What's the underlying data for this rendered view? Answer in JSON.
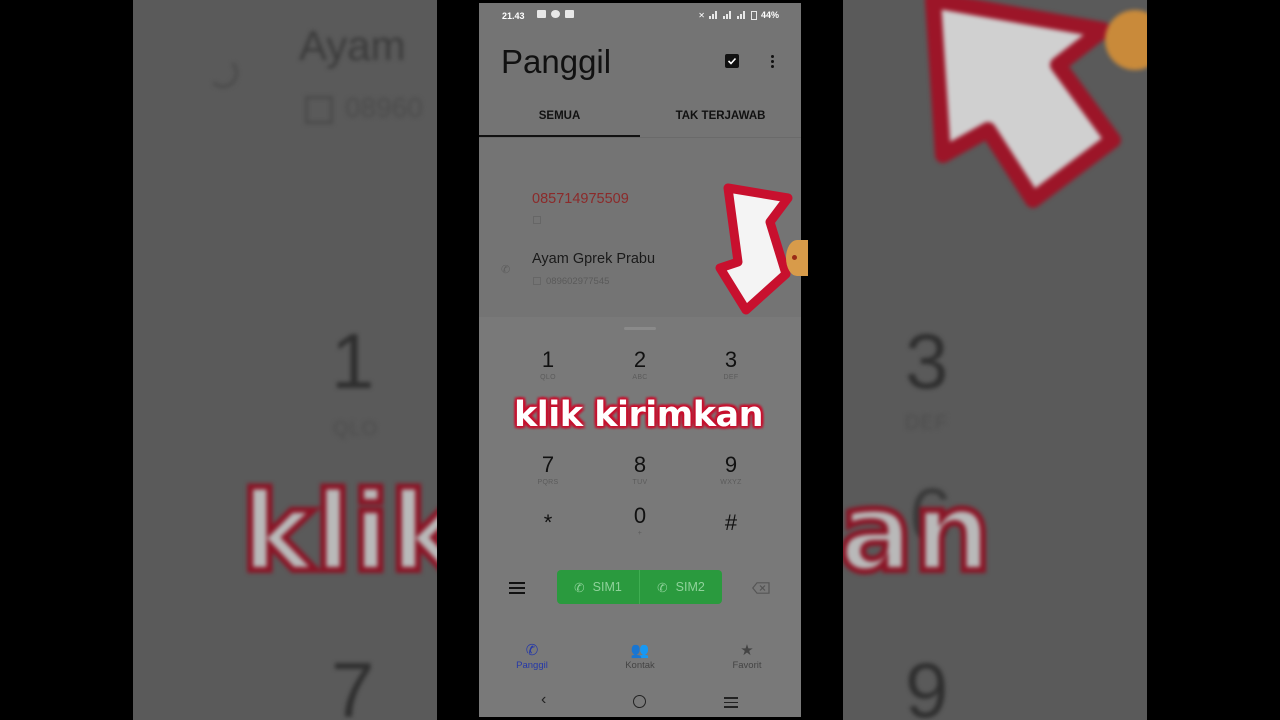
{
  "status_bar": {
    "time": "21.43",
    "battery": "44%"
  },
  "header": {
    "title": "Panggil"
  },
  "tabs": [
    {
      "label": "SEMUA",
      "active": true
    },
    {
      "label": "TAK TERJAWAB",
      "active": false
    }
  ],
  "call_log": [
    {
      "number": "085714975509",
      "missed": true
    },
    {
      "name": "Ayam Gprek Prabu",
      "number": "089602977545"
    }
  ],
  "dialpad": {
    "keys": [
      {
        "digit": "1",
        "letters": "QLO"
      },
      {
        "digit": "2",
        "letters": "ABC"
      },
      {
        "digit": "3",
        "letters": "DEF"
      },
      {
        "digit": "6",
        "letters": ""
      },
      {
        "digit": "7",
        "letters": "PQRS"
      },
      {
        "digit": "8",
        "letters": "TUV"
      },
      {
        "digit": "9",
        "letters": "WXYZ"
      },
      {
        "digit": "*",
        "letters": ""
      },
      {
        "digit": "0",
        "letters": "+"
      },
      {
        "digit": "#",
        "letters": ""
      }
    ],
    "sim1_label": "SIM1",
    "sim2_label": "SIM2"
  },
  "bottom_nav": [
    {
      "label": "Panggil",
      "icon": "phone-icon",
      "active": true
    },
    {
      "label": "Kontak",
      "icon": "contacts-icon",
      "active": false
    },
    {
      "label": "Favorit",
      "icon": "star-icon",
      "active": false
    }
  ],
  "overlay": {
    "caption": "klik kirimkan"
  },
  "background": {
    "left_name": "Ayam",
    "left_number": "08960",
    "left_digit": "1",
    "left_letters": "QLO",
    "left_big_text": "klik",
    "left_bottom_digit": "7",
    "right_digit": "3",
    "right_letters": "DEF",
    "right_mid_digit": "6",
    "right_big_text": "an",
    "right_bottom_digit": "9"
  },
  "colors": {
    "accent_green": "#2a9a3e",
    "missed_red": "#8b2a2a",
    "nav_active": "#2538a8",
    "caption_outline": "#c8102e"
  }
}
